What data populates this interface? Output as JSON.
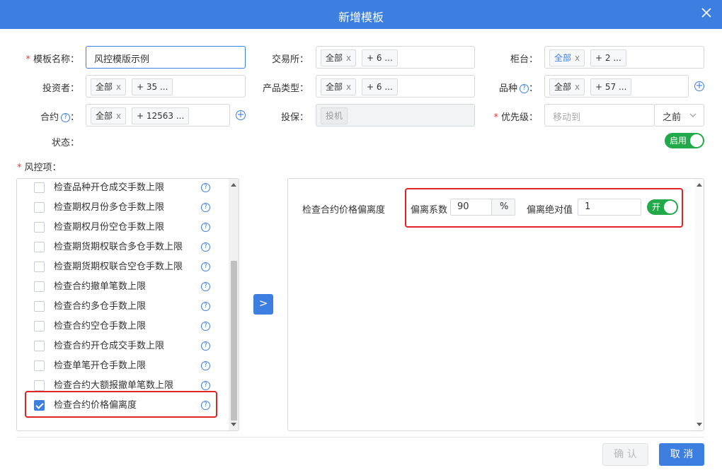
{
  "dialog": {
    "title": "新增模板"
  },
  "form": {
    "template_name": {
      "label": "模板名称：",
      "value": "风控模版示例"
    },
    "exchange": {
      "label": "交易所：",
      "tags": [
        "全部",
        "+ 6 ..."
      ]
    },
    "counter": {
      "label": "柜台：",
      "tags": [
        "全部",
        "+ 2 ..."
      ]
    },
    "investor": {
      "label": "投资者：",
      "tags": [
        "全部",
        "+ 35 ..."
      ]
    },
    "product_type": {
      "label": "产品类型：",
      "tags": [
        "全部",
        "+ 6 ..."
      ]
    },
    "variety": {
      "label": "品种",
      "colon": "：",
      "tags": [
        "全部",
        "+ 57 ..."
      ]
    },
    "contract": {
      "label": "合约",
      "colon": "：",
      "tags": [
        "全部",
        "+ 12563 ..."
      ]
    },
    "hedge": {
      "label": "投保：",
      "tags": [
        "投机"
      ]
    },
    "priority": {
      "label": "优先级：",
      "placeholder": "移动到",
      "select": "之前"
    },
    "status": {
      "label": "状态：",
      "toggle": "启用"
    },
    "risk_items": {
      "label": "风控项："
    }
  },
  "risk_list": [
    {
      "label": "检查品种开仓成交手数上限",
      "checked": false
    },
    {
      "label": "检查期权月份多仓手数上限",
      "checked": false
    },
    {
      "label": "检查期权月份空仓手数上限",
      "checked": false
    },
    {
      "label": "检查期货期权联合多仓手数上限",
      "checked": false
    },
    {
      "label": "检查期货期权联合空仓手数上限",
      "checked": false
    },
    {
      "label": "检查合约撤单笔数上限",
      "checked": false
    },
    {
      "label": "检查合约多仓手数上限",
      "checked": false
    },
    {
      "label": "检查合约空仓手数上限",
      "checked": false
    },
    {
      "label": "检查合约开仓成交手数上限",
      "checked": false
    },
    {
      "label": "检查单笔开仓手数上限",
      "checked": false
    },
    {
      "label": "检查合约大额报撤单笔数上限",
      "checked": false
    },
    {
      "label": "检查合约价格偏离度",
      "checked": true
    }
  ],
  "detail": {
    "item_label": "检查合约价格偏离度",
    "coef_label": "偏离系数",
    "coef_value": "90",
    "coef_unit": "%",
    "abs_label": "偏离绝对值",
    "abs_value": "1",
    "toggle": "开"
  },
  "help_mark": "?",
  "tag_close": "x",
  "plus_mark": "+",
  "transfer_mark": ">",
  "buttons": {
    "confirm": "确 认",
    "cancel": "取 消"
  },
  "colors": {
    "primary": "#3d7fe0",
    "success": "#22a94a",
    "danger": "#e02424"
  }
}
